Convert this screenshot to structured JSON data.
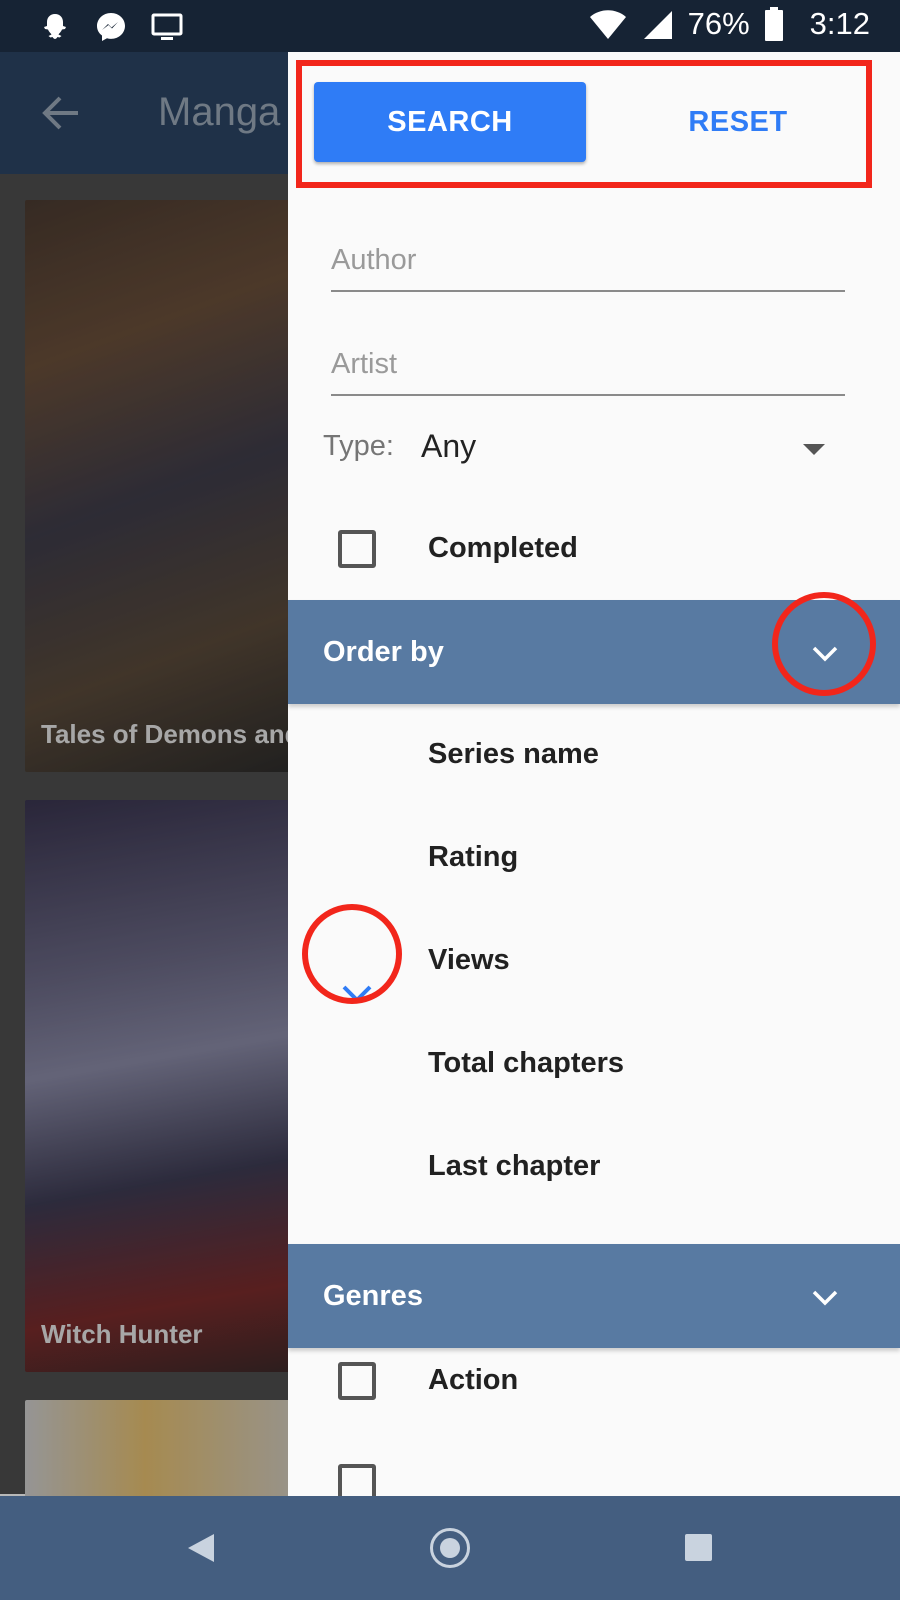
{
  "status_bar": {
    "battery": "76%",
    "time": "3:12",
    "left_icons": [
      "snapchat-icon",
      "messenger-icon",
      "cast-icon"
    ],
    "right_icons": [
      "wifi-icon",
      "signal-icon",
      "battery-icon"
    ]
  },
  "app_bar": {
    "title": "Manga"
  },
  "cards": [
    {
      "title": "Tales of Demons and G"
    },
    {
      "title": "Witch Hunter"
    },
    {
      "title": ""
    }
  ],
  "drawer": {
    "search_label": "SEARCH",
    "reset_label": "RESET",
    "author_placeholder": "Author",
    "artist_placeholder": "Artist",
    "type_label": "Type:",
    "type_value": "Any",
    "completed_label": "Completed",
    "completed_checked": false,
    "order_by": {
      "title": "Order by",
      "items": [
        "Series name",
        "Rating",
        "Views",
        "Total chapters",
        "Last chapter"
      ],
      "selected": "Views"
    },
    "genres": {
      "title": "Genres",
      "items": [
        {
          "label": "Action",
          "checked": false
        }
      ]
    }
  },
  "colors": {
    "accent": "#2f7cf6",
    "section_header": "#587aa2",
    "annotation": "#f2261b",
    "nav_bar": "#445e80"
  }
}
